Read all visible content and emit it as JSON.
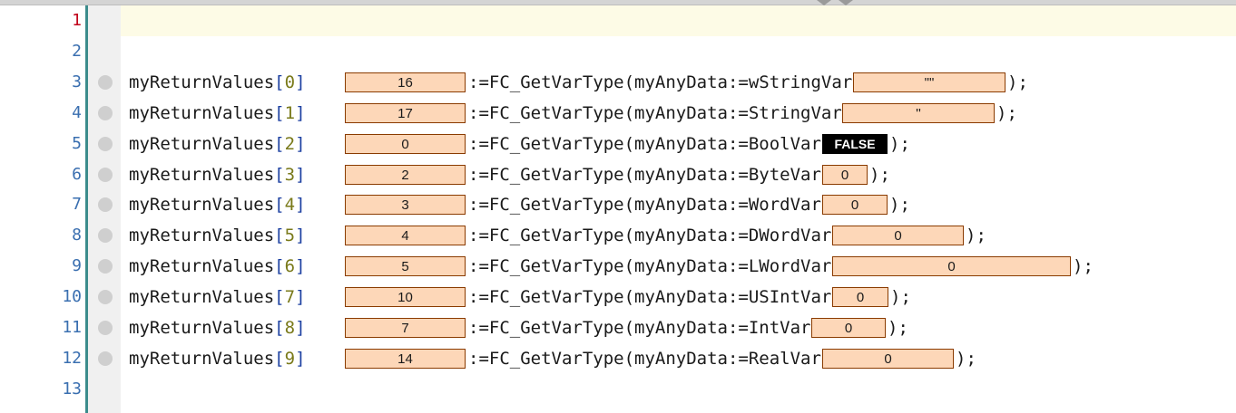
{
  "editor": {
    "line_numbers": [
      "1",
      "2",
      "3",
      "4",
      "5",
      "6",
      "7",
      "8",
      "9",
      "10",
      "11",
      "12",
      "13"
    ],
    "active_line": "1",
    "assignments": [
      {
        "target": "myReturnValues",
        "open": "[",
        "index": "0",
        "close": "]",
        "result": "16",
        "call": ":=FC_GetVarType(myAnyData:=",
        "var": "wStringVar",
        "value": "\"\"",
        "end": ");"
      },
      {
        "target": "myReturnValues",
        "open": "[",
        "index": "1",
        "close": "]",
        "result": "17",
        "call": ":=FC_GetVarType(myAnyData:=",
        "var": "StringVar",
        "value": "''",
        "end": ");"
      },
      {
        "target": "myReturnValues",
        "open": "[",
        "index": "2",
        "close": "]",
        "result": "0",
        "call": ":=FC_GetVarType(myAnyData:=",
        "var": "BoolVar",
        "value": "FALSE",
        "end": ");"
      },
      {
        "target": "myReturnValues",
        "open": "[",
        "index": "3",
        "close": "]",
        "result": "2",
        "call": ":=FC_GetVarType(myAnyData:=",
        "var": "ByteVar",
        "value": "0",
        "end": ");"
      },
      {
        "target": "myReturnValues",
        "open": "[",
        "index": "4",
        "close": "]",
        "result": "3",
        "call": ":=FC_GetVarType(myAnyData:=",
        "var": "WordVar",
        "value": "0",
        "end": ");"
      },
      {
        "target": "myReturnValues",
        "open": "[",
        "index": "5",
        "close": "]",
        "result": "4",
        "call": ":=FC_GetVarType(myAnyData:=",
        "var": "DWordVar",
        "value": "0",
        "end": ");"
      },
      {
        "target": "myReturnValues",
        "open": "[",
        "index": "6",
        "close": "]",
        "result": "5",
        "call": ":=FC_GetVarType(myAnyData:=",
        "var": "LWordVar",
        "value": "0",
        "end": ");"
      },
      {
        "target": "myReturnValues",
        "open": "[",
        "index": "7",
        "close": "]",
        "result": "10",
        "call": ":=FC_GetVarType(myAnyData:=",
        "var": "USIntVar",
        "value": "0",
        "end": ");"
      },
      {
        "target": "myReturnValues",
        "open": "[",
        "index": "8",
        "close": "]",
        "result": "7",
        "call": ":=FC_GetVarType(myAnyData:=",
        "var": "IntVar",
        "value": "0",
        "end": ");"
      },
      {
        "target": "myReturnValues",
        "open": "[",
        "index": "9",
        "close": "]",
        "result": "14",
        "call": ":=FC_GetVarType(myAnyData:=",
        "var": "RealVar",
        "value": "0",
        "end": ");"
      }
    ]
  },
  "colors": {
    "value_box_bg": "#fdd7b8",
    "value_box_border": "#8a3b00",
    "line_number": "#3a6fb0",
    "active_line_number": "#c1001a",
    "gutter_line": "#3c8c8c",
    "current_line_highlight": "#fdfbe6"
  }
}
